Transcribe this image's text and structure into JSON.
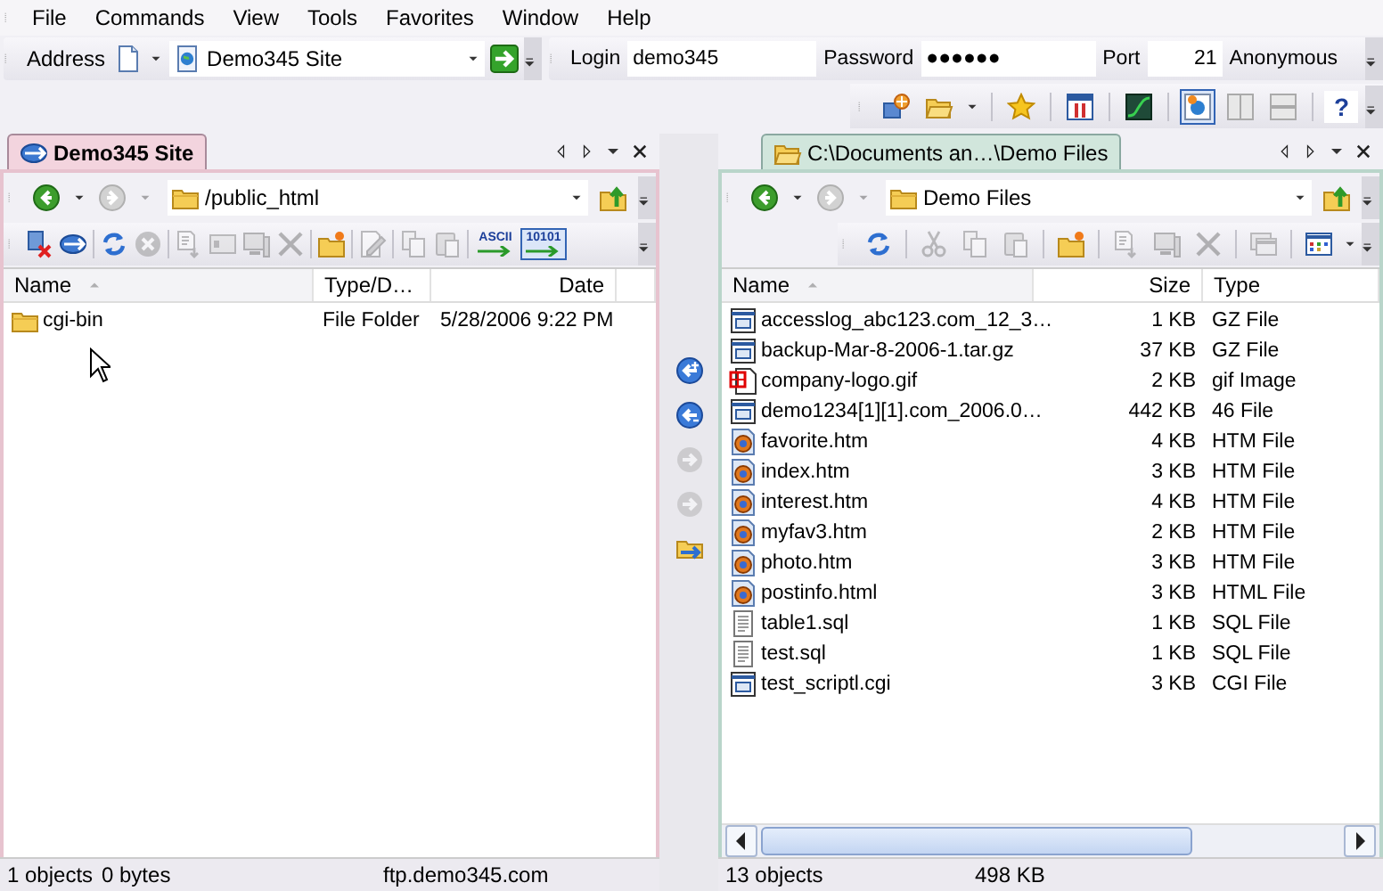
{
  "menu": [
    {
      "label": "File"
    },
    {
      "label": "Commands"
    },
    {
      "label": "View"
    },
    {
      "label": "Tools"
    },
    {
      "label": "Favorites"
    },
    {
      "label": "Window"
    },
    {
      "label": "Help"
    }
  ],
  "address_bar": {
    "label": "Address",
    "site": "Demo345 Site",
    "login_label": "Login",
    "login": "demo345",
    "password_label": "Password",
    "password": "●●●●●●",
    "port_label": "Port",
    "port": "21",
    "anonymous": "Anonymous"
  },
  "toolbar": [
    [
      {
        "kind": "sites",
        "disabled": false,
        "pressed": false
      },
      {
        "kind": "openfolder",
        "disabled": false,
        "pressed": false
      }
    ],
    [
      {
        "kind": "star",
        "disabled": false,
        "pressed": false
      }
    ],
    [
      {
        "kind": "transfer",
        "disabled": false,
        "pressed": false
      }
    ],
    [
      {
        "kind": "graph",
        "disabled": false,
        "pressed": false
      }
    ],
    [
      {
        "kind": "single",
        "disabled": false,
        "pressed": true
      },
      {
        "kind": "columns",
        "disabled": false,
        "pressed": false
      },
      {
        "kind": "rows",
        "disabled": false,
        "pressed": false
      }
    ],
    [
      {
        "kind": "help",
        "label": "?",
        "disabled": false,
        "pressed": false
      }
    ]
  ],
  "panes": [
    {
      "tab": {
        "label": "Demo345 Site",
        "selected": true
      },
      "path": "/public_html",
      "toolbar": [
        [
          {
            "kind": "disconnect",
            "disabled": false,
            "pressed": false
          },
          {
            "kind": "reconnect",
            "disabled": false,
            "pressed": false
          }
        ],
        [
          {
            "kind": "refresh",
            "disabled": false,
            "pressed": false
          },
          {
            "kind": "stop",
            "disabled": true,
            "pressed": false
          }
        ],
        [
          {
            "kind": "view",
            "disabled": true,
            "pressed": false
          },
          {
            "kind": "console",
            "disabled": true,
            "pressed": false
          },
          {
            "kind": "properties",
            "disabled": true,
            "pressed": false
          },
          {
            "kind": "delete",
            "disabled": true,
            "pressed": false
          }
        ],
        [
          {
            "kind": "newfolder",
            "disabled": false,
            "pressed": false
          }
        ],
        [
          {
            "kind": "rename",
            "disabled": true,
            "pressed": false
          }
        ],
        [
          {
            "kind": "copy",
            "disabled": true,
            "pressed": false
          },
          {
            "kind": "paste",
            "disabled": true,
            "pressed": false
          }
        ],
        [
          {
            "kind": "ascii",
            "label": "ASCII",
            "disabled": false,
            "pressed": false
          },
          {
            "kind": "binary",
            "label": "10101",
            "disabled": false,
            "pressed": true
          }
        ]
      ],
      "columns": [
        {
          "label": "Name",
          "kind": "name",
          "sorted": true
        },
        {
          "label": "Type/D…",
          "kind": "type",
          "sorted": false
        },
        {
          "label": "Date",
          "kind": "date",
          "sorted": false
        }
      ],
      "rows": [
        {
          "kind": "folder",
          "cells": [
            "cgi-bin",
            "File Folder",
            "5/28/2006 9:22 PM"
          ]
        }
      ],
      "status": [
        "1 objects",
        "0 bytes",
        "ftp.demo345.com"
      ]
    },
    {
      "tab": {
        "label": "C:\\Documents an…\\Demo Files",
        "selected": false
      },
      "path": "Demo Files",
      "toolbar": [
        [
          {
            "kind": "refresh",
            "disabled": false,
            "pressed": false
          }
        ],
        [
          {
            "kind": "cut",
            "disabled": true,
            "pressed": false
          },
          {
            "kind": "copy",
            "disabled": true,
            "pressed": false
          },
          {
            "kind": "paste",
            "disabled": true,
            "pressed": false
          }
        ],
        [
          {
            "kind": "newfolder",
            "disabled": false,
            "pressed": false
          }
        ],
        [
          {
            "kind": "view",
            "disabled": true,
            "pressed": false
          },
          {
            "kind": "properties",
            "disabled": true,
            "pressed": false
          },
          {
            "kind": "delete",
            "disabled": true,
            "pressed": false
          }
        ],
        [
          {
            "kind": "window",
            "disabled": true,
            "pressed": false
          }
        ],
        [
          {
            "kind": "viewmode",
            "disabled": false,
            "pressed": false
          }
        ]
      ],
      "columns": [
        {
          "label": "Name",
          "kind": "name",
          "sorted": true
        },
        {
          "label": "Size",
          "kind": "size",
          "sorted": false
        },
        {
          "label": "Type",
          "kind": "type",
          "sorted": false
        }
      ],
      "rows": [
        {
          "kind": "app",
          "cells": [
            "accesslog_abc123.com_12_3…",
            "1 KB",
            "GZ File"
          ]
        },
        {
          "kind": "app",
          "cells": [
            "backup-Mar-8-2006-1.tar.gz",
            "37 KB",
            "GZ File"
          ]
        },
        {
          "kind": "image",
          "cells": [
            "company-logo.gif",
            "2 KB",
            "gif Image"
          ]
        },
        {
          "kind": "app",
          "cells": [
            "demo1234[1][1].com_2006.0…",
            "442 KB",
            "46 File"
          ]
        },
        {
          "kind": "web",
          "cells": [
            "favorite.htm",
            "4 KB",
            "HTM File"
          ]
        },
        {
          "kind": "web",
          "cells": [
            "index.htm",
            "3 KB",
            "HTM File"
          ]
        },
        {
          "kind": "web",
          "cells": [
            "interest.htm",
            "4 KB",
            "HTM File"
          ]
        },
        {
          "kind": "web",
          "cells": [
            "myfav3.htm",
            "2 KB",
            "HTM File"
          ]
        },
        {
          "kind": "web",
          "cells": [
            "photo.htm",
            "3 KB",
            "HTM File"
          ]
        },
        {
          "kind": "web",
          "cells": [
            "postinfo.html",
            "3 KB",
            "HTML File"
          ]
        },
        {
          "kind": "text",
          "cells": [
            "table1.sql",
            "1 KB",
            "SQL File"
          ]
        },
        {
          "kind": "text",
          "cells": [
            "test.sql",
            "1 KB",
            "SQL File"
          ]
        },
        {
          "kind": "app",
          "cells": [
            "test_scriptl.cgi",
            "3 KB",
            "CGI File"
          ]
        }
      ],
      "status": [
        "13 objects",
        "498 KB"
      ]
    }
  ],
  "transfer_buttons": [
    {
      "kind": "upload",
      "disabled": false
    },
    {
      "kind": "upload-all",
      "disabled": false
    },
    {
      "kind": "download",
      "disabled": true
    },
    {
      "kind": "download-all",
      "disabled": true
    },
    {
      "kind": "queue",
      "disabled": false
    }
  ]
}
